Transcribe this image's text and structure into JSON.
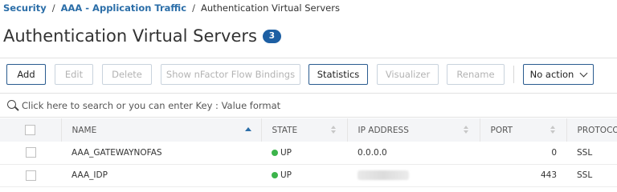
{
  "breadcrumb": {
    "items": [
      {
        "label": "Security"
      },
      {
        "label": "AAA - Application Traffic"
      },
      {
        "label": "Authentication Virtual Servers"
      }
    ],
    "separator": "/"
  },
  "page": {
    "title": "Authentication Virtual Servers",
    "count": "3"
  },
  "toolbar": {
    "add": "Add",
    "edit": "Edit",
    "delete": "Delete",
    "show_nfactor": "Show nFactor Flow Bindings",
    "statistics": "Statistics",
    "visualizer": "Visualizer",
    "rename": "Rename",
    "action_select": "No action"
  },
  "search": {
    "placeholder": "Click here to search or you can enter Key : Value format"
  },
  "table": {
    "columns": [
      "NAME",
      "STATE",
      "IP ADDRESS",
      "PORT",
      "PROTOCOL"
    ],
    "rows": [
      {
        "name": "AAA_GATEWAYNOFAS",
        "state": "UP",
        "ip": "0.0.0.0",
        "port": "0",
        "protocol": "SSL"
      },
      {
        "name": "AAA_IDP",
        "state": "UP",
        "ip": "",
        "port": "443",
        "protocol": "SSL"
      }
    ]
  },
  "colors": {
    "link": "#2b6ea8",
    "badge": "#1d5fa3",
    "button_border": "#2a5b8f",
    "status_up": "#3cb44b"
  }
}
